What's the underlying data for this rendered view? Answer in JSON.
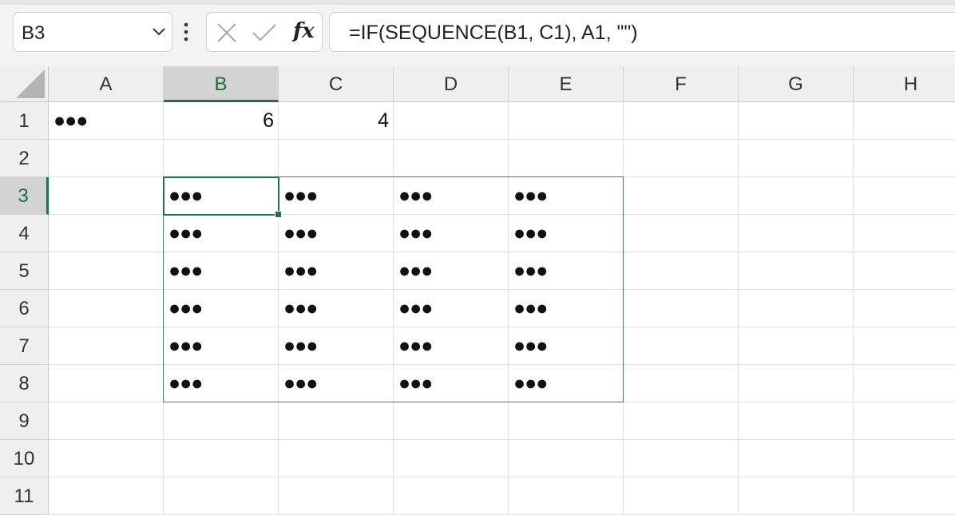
{
  "name_box": {
    "value": "B3"
  },
  "formula_bar": {
    "cancel_icon": "x-icon",
    "enter_icon": "check-icon",
    "fx_label": "fx",
    "formula": "=IF(SEQUENCE(B1, C1), A1, \"\")"
  },
  "columns": [
    "A",
    "B",
    "C",
    "D",
    "E",
    "F",
    "G",
    "H"
  ],
  "rows": [
    "1",
    "2",
    "3",
    "4",
    "5",
    "6",
    "7",
    "8",
    "9",
    "10",
    "11"
  ],
  "selection": {
    "active_cell": "B3",
    "active_column": "B",
    "active_row": "3",
    "spill_range": "B3:E8"
  },
  "cells": [
    {
      "ref": "A1",
      "value": "●●●",
      "type": "text"
    },
    {
      "ref": "B1",
      "value": "6",
      "type": "number"
    },
    {
      "ref": "C1",
      "value": "4",
      "type": "number"
    },
    {
      "ref": "B3",
      "value": "●●●",
      "type": "text"
    },
    {
      "ref": "C3",
      "value": "●●●",
      "type": "text"
    },
    {
      "ref": "D3",
      "value": "●●●",
      "type": "text"
    },
    {
      "ref": "E3",
      "value": "●●●",
      "type": "text"
    },
    {
      "ref": "B4",
      "value": "●●●",
      "type": "text"
    },
    {
      "ref": "C4",
      "value": "●●●",
      "type": "text"
    },
    {
      "ref": "D4",
      "value": "●●●",
      "type": "text"
    },
    {
      "ref": "E4",
      "value": "●●●",
      "type": "text"
    },
    {
      "ref": "B5",
      "value": "●●●",
      "type": "text"
    },
    {
      "ref": "C5",
      "value": "●●●",
      "type": "text"
    },
    {
      "ref": "D5",
      "value": "●●●",
      "type": "text"
    },
    {
      "ref": "E5",
      "value": "●●●",
      "type": "text"
    },
    {
      "ref": "B6",
      "value": "●●●",
      "type": "text"
    },
    {
      "ref": "C6",
      "value": "●●●",
      "type": "text"
    },
    {
      "ref": "D6",
      "value": "●●●",
      "type": "text"
    },
    {
      "ref": "E6",
      "value": "●●●",
      "type": "text"
    },
    {
      "ref": "B7",
      "value": "●●●",
      "type": "text"
    },
    {
      "ref": "C7",
      "value": "●●●",
      "type": "text"
    },
    {
      "ref": "D7",
      "value": "●●●",
      "type": "text"
    },
    {
      "ref": "E7",
      "value": "●●●",
      "type": "text"
    },
    {
      "ref": "B8",
      "value": "●●●",
      "type": "text"
    },
    {
      "ref": "C8",
      "value": "●●●",
      "type": "text"
    },
    {
      "ref": "D8",
      "value": "●●●",
      "type": "text"
    },
    {
      "ref": "E8",
      "value": "●●●",
      "type": "text"
    }
  ],
  "colors": {
    "accent": "#217346",
    "spill_border": "#4a6fb0",
    "header_bg": "#efefef",
    "header_selected_bg": "#d3d3d3"
  }
}
